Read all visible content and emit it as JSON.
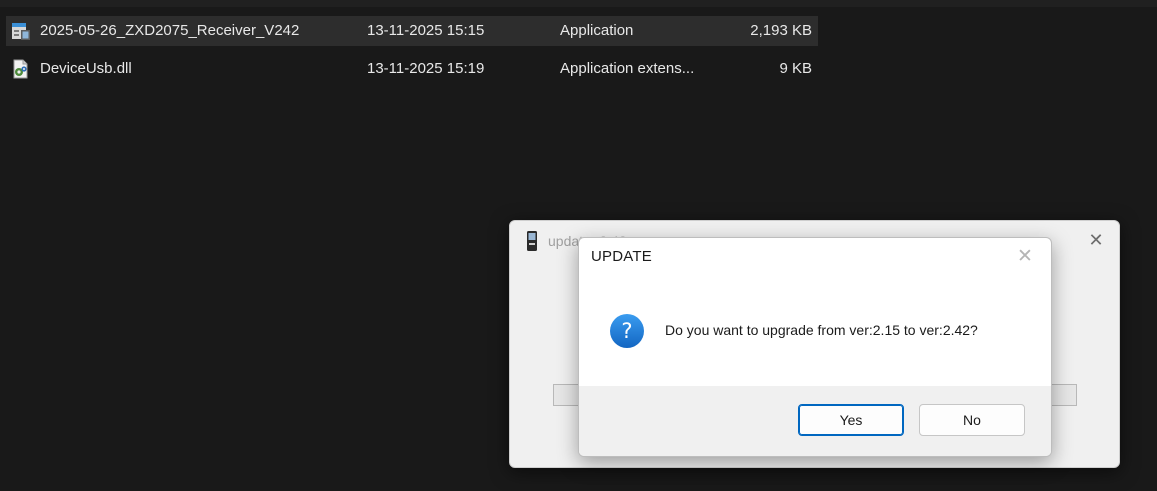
{
  "files": [
    {
      "name": "2025-05-26_ZXD2075_Receiver_V242",
      "date": "13-11-2025 15:15",
      "type": "Application",
      "size": "2,193 KB",
      "icon": "application-exe-icon",
      "selected": true
    },
    {
      "name": "DeviceUsb.dll",
      "date": "13-11-2025 15:19",
      "type": "Application extens...",
      "size": "9 KB",
      "icon": "dll-gear-file-icon",
      "selected": false
    }
  ],
  "background_window": {
    "title": "updater 2.42",
    "icon": "application-exe-icon",
    "close_glyph": "✕"
  },
  "dialog": {
    "title": "UPDATE",
    "close_glyph": "✕",
    "icon": "question-icon",
    "icon_glyph": "?",
    "message": "Do you want to upgrade from ver:2.15 to ver:2.42?",
    "yes_label": "Yes",
    "no_label": "No"
  },
  "colors": {
    "background": "#191919",
    "selected_row": "#2d2d2d",
    "accent": "#0067c0",
    "question_icon": "#1a7fd8"
  }
}
